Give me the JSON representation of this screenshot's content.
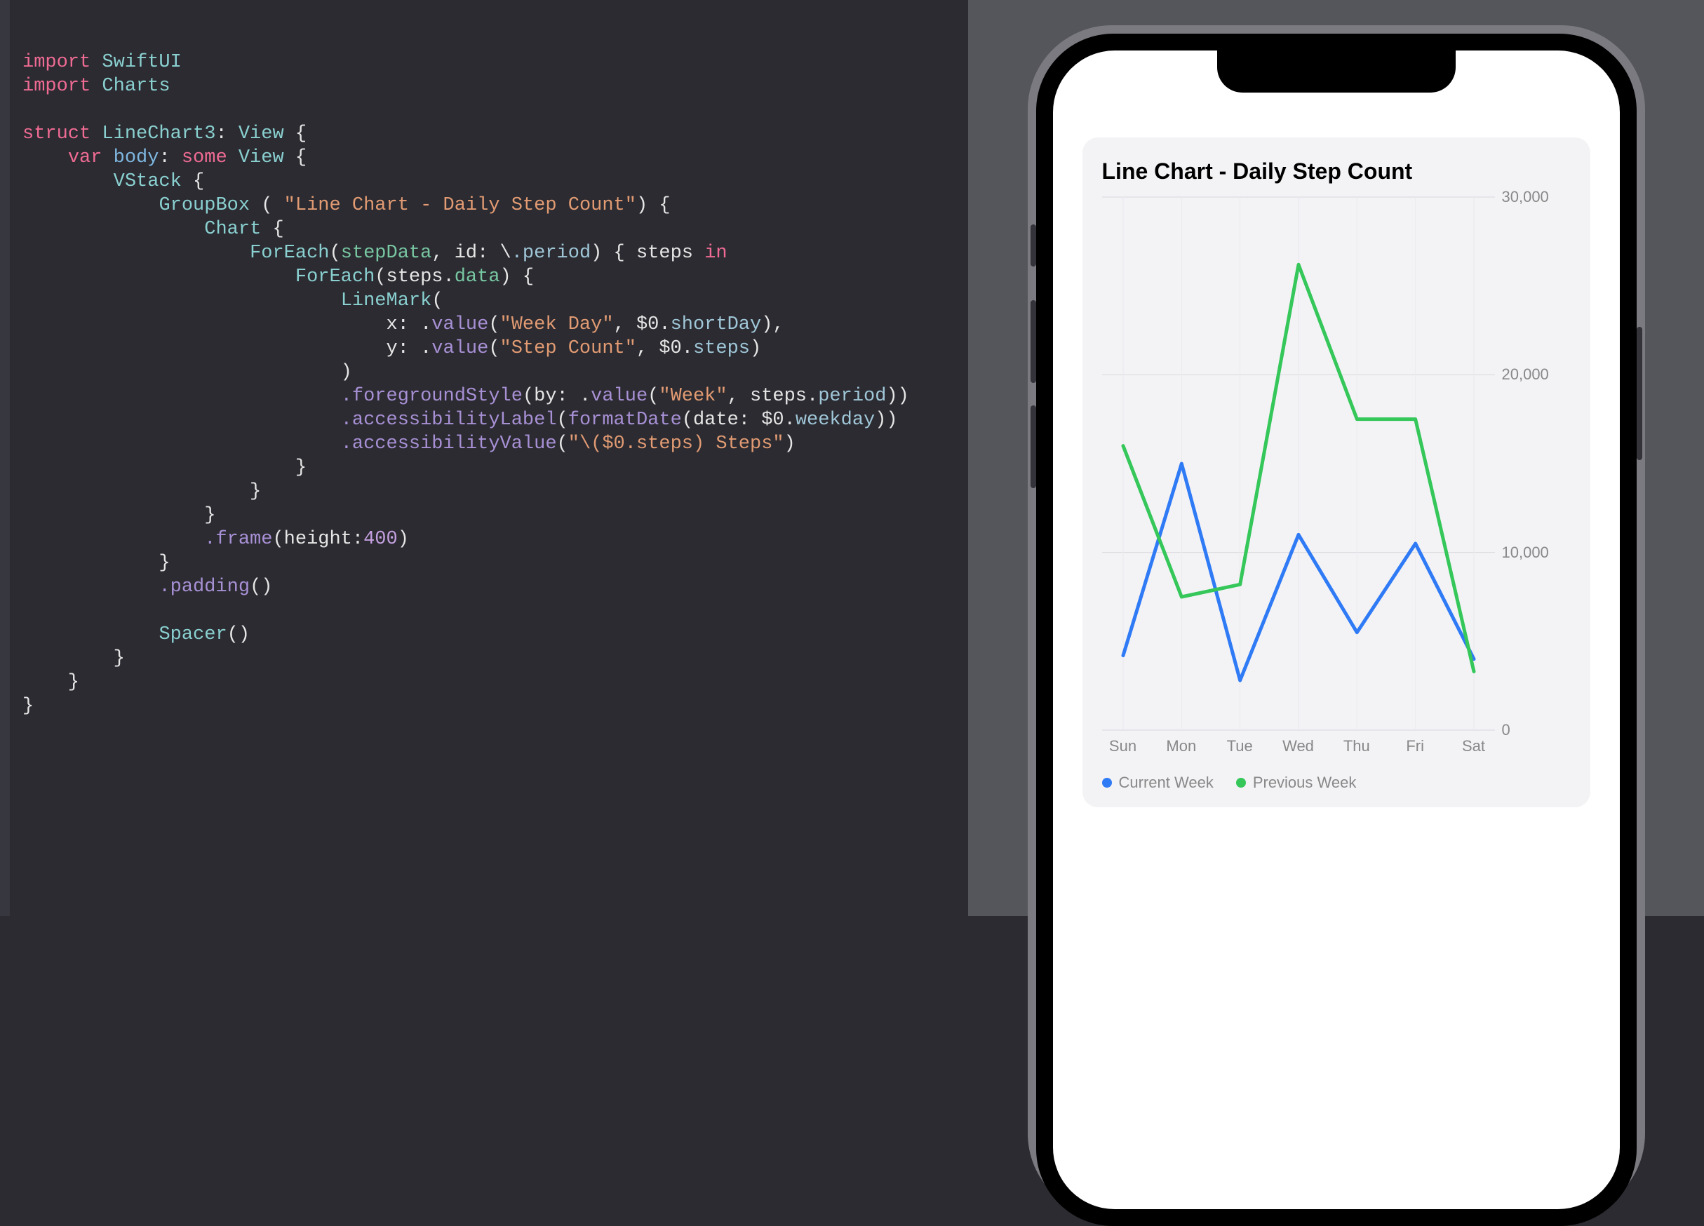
{
  "code": {
    "tokens": [
      [
        [
          "kw",
          "import"
        ],
        [
          "punc",
          " "
        ],
        [
          "type",
          "SwiftUI"
        ]
      ],
      [
        [
          "kw",
          "import"
        ],
        [
          "punc",
          " "
        ],
        [
          "type",
          "Charts"
        ]
      ],
      [
        [
          "punc",
          ""
        ]
      ],
      [
        [
          "kw",
          "struct"
        ],
        [
          "punc",
          " "
        ],
        [
          "type",
          "LineChart3"
        ],
        [
          "punc",
          ": "
        ],
        [
          "type",
          "View"
        ],
        [
          "punc",
          " {"
        ]
      ],
      [
        [
          "punc",
          "    "
        ],
        [
          "kw",
          "var"
        ],
        [
          "punc",
          " "
        ],
        [
          "name",
          "body"
        ],
        [
          "punc",
          ": "
        ],
        [
          "kw",
          "some"
        ],
        [
          "punc",
          " "
        ],
        [
          "type",
          "View"
        ],
        [
          "punc",
          " {"
        ]
      ],
      [
        [
          "punc",
          "        "
        ],
        [
          "type",
          "VStack"
        ],
        [
          "punc",
          " {"
        ]
      ],
      [
        [
          "punc",
          "            "
        ],
        [
          "type",
          "GroupBox"
        ],
        [
          "punc",
          " ( "
        ],
        [
          "str",
          "\"Line Chart - Daily Step Count\""
        ],
        [
          "punc",
          ") {"
        ]
      ],
      [
        [
          "punc",
          "                "
        ],
        [
          "type",
          "Chart"
        ],
        [
          "punc",
          " {"
        ]
      ],
      [
        [
          "punc",
          "                    "
        ],
        [
          "type",
          "ForEach"
        ],
        [
          "punc",
          "("
        ],
        [
          "id",
          "stepData"
        ],
        [
          "punc",
          ", id: \\"
        ],
        [
          "mem",
          ".period"
        ],
        [
          "punc",
          ") { steps "
        ],
        [
          "kw",
          "in"
        ]
      ],
      [
        [
          "punc",
          "                        "
        ],
        [
          "type",
          "ForEach"
        ],
        [
          "punc",
          "(steps."
        ],
        [
          "id",
          "data"
        ],
        [
          "punc",
          ") {"
        ]
      ],
      [
        [
          "punc",
          "                            "
        ],
        [
          "type",
          "LineMark"
        ],
        [
          "punc",
          "("
        ]
      ],
      [
        [
          "punc",
          "                                x: ."
        ],
        [
          "fn",
          "value"
        ],
        [
          "punc",
          "("
        ],
        [
          "str",
          "\"Week Day\""
        ],
        [
          "punc",
          ", $0."
        ],
        [
          "mem",
          "shortDay"
        ],
        [
          "punc",
          "),"
        ]
      ],
      [
        [
          "punc",
          "                                y: ."
        ],
        [
          "fn",
          "value"
        ],
        [
          "punc",
          "("
        ],
        [
          "str",
          "\"Step Count\""
        ],
        [
          "punc",
          ", $0."
        ],
        [
          "mem",
          "steps"
        ],
        [
          "punc",
          ")"
        ]
      ],
      [
        [
          "punc",
          "                            )"
        ]
      ],
      [
        [
          "punc",
          "                            "
        ],
        [
          "mod",
          ".foregroundStyle"
        ],
        [
          "punc",
          "(by: ."
        ],
        [
          "fn",
          "value"
        ],
        [
          "punc",
          "("
        ],
        [
          "str",
          "\"Week\""
        ],
        [
          "punc",
          ", steps."
        ],
        [
          "mem",
          "period"
        ],
        [
          "punc",
          "))"
        ]
      ],
      [
        [
          "punc",
          "                            "
        ],
        [
          "mod",
          ".accessibilityLabel"
        ],
        [
          "punc",
          "("
        ],
        [
          "fn",
          "formatDate"
        ],
        [
          "punc",
          "(date: $0."
        ],
        [
          "mem",
          "weekday"
        ],
        [
          "punc",
          "))"
        ]
      ],
      [
        [
          "punc",
          "                            "
        ],
        [
          "mod",
          ".accessibilityValue"
        ],
        [
          "punc",
          "("
        ],
        [
          "str",
          "\"\\($0.steps) Steps\""
        ],
        [
          "punc",
          ")"
        ]
      ],
      [
        [
          "punc",
          "                        }"
        ]
      ],
      [
        [
          "punc",
          "                    }"
        ]
      ],
      [
        [
          "punc",
          "                }"
        ]
      ],
      [
        [
          "punc",
          "                "
        ],
        [
          "mod",
          ".frame"
        ],
        [
          "punc",
          "(height:"
        ],
        [
          "num",
          "400"
        ],
        [
          "punc",
          ")"
        ]
      ],
      [
        [
          "punc",
          "            }"
        ]
      ],
      [
        [
          "punc",
          "            "
        ],
        [
          "mod",
          ".padding"
        ],
        [
          "punc",
          "()"
        ]
      ],
      [
        [
          "punc",
          ""
        ]
      ],
      [
        [
          "punc",
          "            "
        ],
        [
          "type",
          "Spacer"
        ],
        [
          "punc",
          "()"
        ]
      ],
      [
        [
          "punc",
          "        }"
        ]
      ],
      [
        [
          "punc",
          "    }"
        ]
      ],
      [
        [
          "punc",
          "}"
        ]
      ]
    ]
  },
  "chart_data": {
    "type": "line",
    "title": "Line Chart - Daily Step Count",
    "xlabel": "",
    "ylabel": "",
    "ylim": [
      0,
      30000
    ],
    "yticks": [
      0,
      10000,
      20000,
      30000
    ],
    "ytick_labels": [
      "0",
      "10,000",
      "20,000",
      "30,000"
    ],
    "categories": [
      "Sun",
      "Mon",
      "Tue",
      "Wed",
      "Thu",
      "Fri",
      "Sat"
    ],
    "series": [
      {
        "name": "Current Week",
        "color": "#2f7af5",
        "values": [
          4200,
          15000,
          2800,
          11000,
          5500,
          10500,
          4000
        ]
      },
      {
        "name": "Previous Week",
        "color": "#35c759",
        "values": [
          16000,
          7500,
          8200,
          26200,
          17500,
          17500,
          3300
        ]
      }
    ],
    "legend_position": "bottom"
  }
}
